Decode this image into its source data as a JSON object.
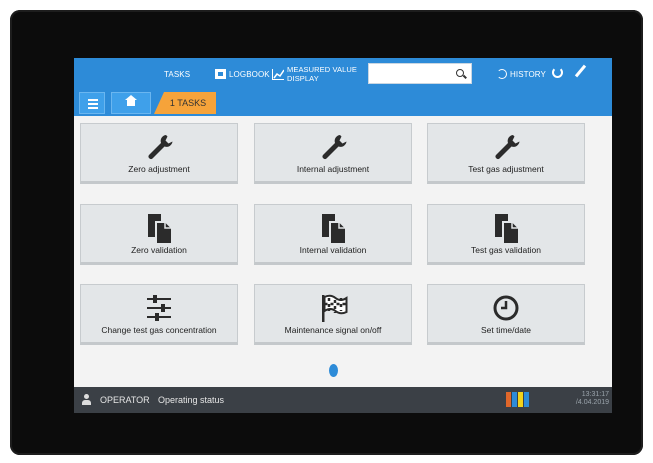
{
  "nav": {
    "tasks": "TASKS",
    "logbook": "LOGBOOK",
    "measured_line1": "MEASURED VALUE",
    "measured_line2": "DISPLAY",
    "history": "HISTORY",
    "search_value": ""
  },
  "breadcrumb": {
    "current": "1  TASKS"
  },
  "tiles": [
    {
      "label": "Zero adjustment",
      "icon": "wrench-icon"
    },
    {
      "label": "Internal adjustment",
      "icon": "wrench-icon"
    },
    {
      "label": "Test gas adjustment",
      "icon": "wrench-icon"
    },
    {
      "label": "Zero validation",
      "icon": "document-icon"
    },
    {
      "label": "Internal validation",
      "icon": "document-icon"
    },
    {
      "label": "Test gas validation",
      "icon": "document-icon"
    },
    {
      "label": "Change test gas concentration",
      "icon": "sliders-icon"
    },
    {
      "label": "Maintenance signal on/off",
      "icon": "flag-icon"
    },
    {
      "label": "Set time/date",
      "icon": "clock-icon"
    }
  ],
  "footer": {
    "role": "OPERATOR",
    "status": "Operating status",
    "time": "13:31:17",
    "date": "/4.04.2019"
  },
  "colors": {
    "header": "#2d8bd8",
    "accent": "#f6a33a",
    "tile": "#e3e6e8",
    "footer": "#3b4046",
    "status_bars": [
      "#e0672a",
      "#2d8bd8",
      "#f2d21b",
      "#2d8bd8"
    ]
  }
}
